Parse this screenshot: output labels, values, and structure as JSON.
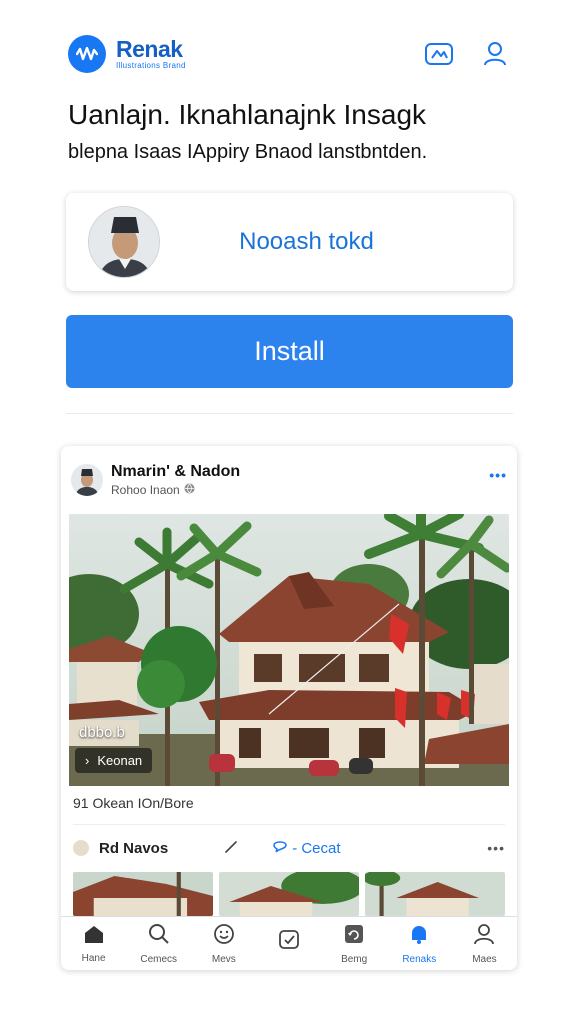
{
  "app": {
    "name": "Renak",
    "tagline": "Illustrations Brand"
  },
  "headline": "Uanlajn. Iknahlanajnk Insagk",
  "subhead": "blepna Isaas IAppiry Bnaod lanstbntden.",
  "profile": {
    "name": "Nooash tokd"
  },
  "install_button": {
    "label": "Install"
  },
  "post": {
    "author": "Nmarin' & Nadon",
    "time": "Rohoo Inaon",
    "more": "•••",
    "image_label": "dbbo.b",
    "image_chip": "Keonan",
    "caption": "91 Okean IOn/Bore",
    "actions": {
      "label": "Rd Navos",
      "comment": "- Cecat",
      "more": "•••"
    }
  },
  "bottom_nav": [
    {
      "label": "Hane",
      "icon": "home-icon"
    },
    {
      "label": "Cemecs",
      "icon": "search-icon"
    },
    {
      "label": "Mevs",
      "icon": "smile-icon"
    },
    {
      "label": "",
      "icon": "check-square-icon"
    },
    {
      "label": "Bemg",
      "icon": "refresh-icon"
    },
    {
      "label": "Renaks",
      "icon": "bell-icon"
    },
    {
      "label": "Maes",
      "icon": "user-icon"
    }
  ],
  "colors": {
    "accent": "#1877f2",
    "install": "#2d83ee",
    "text": "#111111"
  }
}
